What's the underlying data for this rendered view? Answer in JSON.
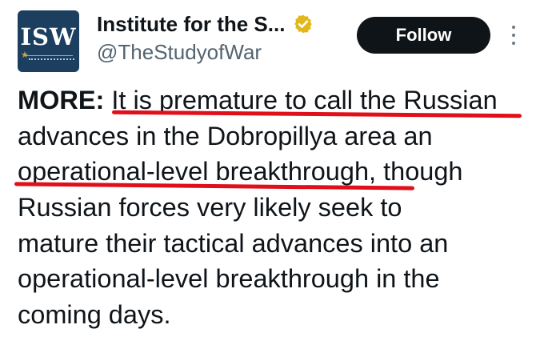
{
  "author": {
    "avatar_text": "ISW",
    "display_name": "Institute for the S...",
    "handle": "@TheStudyofWar",
    "verified_icon": "verified-badge-gold-icon"
  },
  "actions": {
    "follow_label": "Follow",
    "more_icon": "more-options-icon"
  },
  "post": {
    "lead": "MORE:",
    "line1_rest": " It is premature to call the Russian",
    "line2": "advances in the Dobropillya area an",
    "line3_start": "operational-level breakthrough,",
    "line3_rest": " though",
    "line4": "Russian forces very likely seek to",
    "line5": "mature their tactical advances into an",
    "line6": "operational-level breakthrough in the",
    "line7": "coming days."
  },
  "highlight_color": "#e0101a"
}
